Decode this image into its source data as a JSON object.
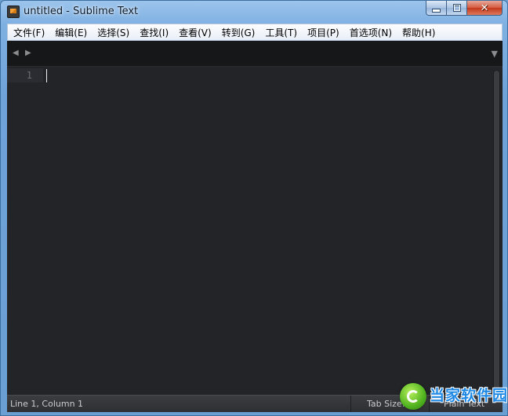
{
  "window": {
    "title": "untitled - Sublime Text",
    "controls": [
      "minimize",
      "maximize",
      "close"
    ]
  },
  "menu": {
    "items": [
      {
        "label": "文件(F)"
      },
      {
        "label": "编辑(E)"
      },
      {
        "label": "选择(S)"
      },
      {
        "label": "查找(I)"
      },
      {
        "label": "查看(V)"
      },
      {
        "label": "转到(G)"
      },
      {
        "label": "工具(T)"
      },
      {
        "label": "项目(P)"
      },
      {
        "label": "首选项(N)"
      },
      {
        "label": "帮助(H)"
      }
    ]
  },
  "tabbar": {
    "nav_left_icon": "◀",
    "nav_right_icon": "▶",
    "dropdown_icon": "▼"
  },
  "editor": {
    "line_numbers": [
      "1"
    ],
    "content": ""
  },
  "statusbar": {
    "position": "Line 1, Column 1",
    "tab_size": "Tab Size: 4",
    "syntax": "Plain Text"
  },
  "watermark": {
    "brand": "当家软件园"
  },
  "colors": {
    "editor_bg": "#232428",
    "tabbar_bg": "#161718",
    "statusbar_bg": "#2d2f33",
    "frame_blue": "#6fa3d8"
  }
}
